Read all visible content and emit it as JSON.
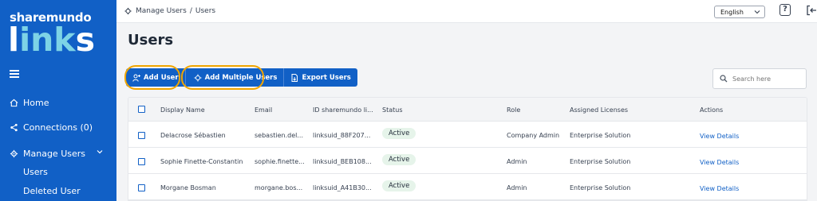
{
  "brand": {
    "top": "sharemundo",
    "big_a": "l",
    "big_ink": "ink",
    "big_b": "s"
  },
  "sidebar": {
    "items": [
      {
        "label": "Home",
        "icon": "home-icon"
      },
      {
        "label": "Connections (0)",
        "icon": "share-icon"
      },
      {
        "label": "Manage Users",
        "icon": "users-gear-icon"
      }
    ],
    "subitems": [
      {
        "label": "Users"
      },
      {
        "label": "Deleted User"
      }
    ]
  },
  "topbar": {
    "breadcrumb": {
      "section": "Manage Users",
      "separator": "/",
      "page": "Users"
    },
    "language": "English",
    "help": "?"
  },
  "main": {
    "title": "Users",
    "buttons": {
      "add_user": "Add User",
      "add_multiple": "Add Multiple Users",
      "export": "Export Users"
    },
    "search": {
      "placeholder": "Search here"
    }
  },
  "table": {
    "headers": [
      "Display Name",
      "Email",
      "ID sharemundo li...",
      "Status",
      "Role",
      "Assigned Licenses",
      "Actions"
    ],
    "rows": [
      {
        "name": "Delacrose Sébastien",
        "email": "sebastien.del...",
        "id": "linksuid_88F207...",
        "status": "Active",
        "role": "Company Admin",
        "license": "Enterprise Solution",
        "action": "View Details"
      },
      {
        "name": "Sophie Finette-Constantin",
        "email": "sophie.finette...",
        "id": "linksuid_BEB108...",
        "status": "Active",
        "role": "Admin",
        "license": "Enterprise Solution",
        "action": "View Details"
      },
      {
        "name": "Morgane Bosman",
        "email": "morgane.bos...",
        "id": "linksuid_A41B30...",
        "status": "Active",
        "role": "Admin",
        "license": "Enterprise Solution",
        "action": "View Details"
      }
    ]
  },
  "colors": {
    "primary": "#1160c6",
    "highlight": "#f0a500",
    "status_bg": "#e6f4ea"
  }
}
